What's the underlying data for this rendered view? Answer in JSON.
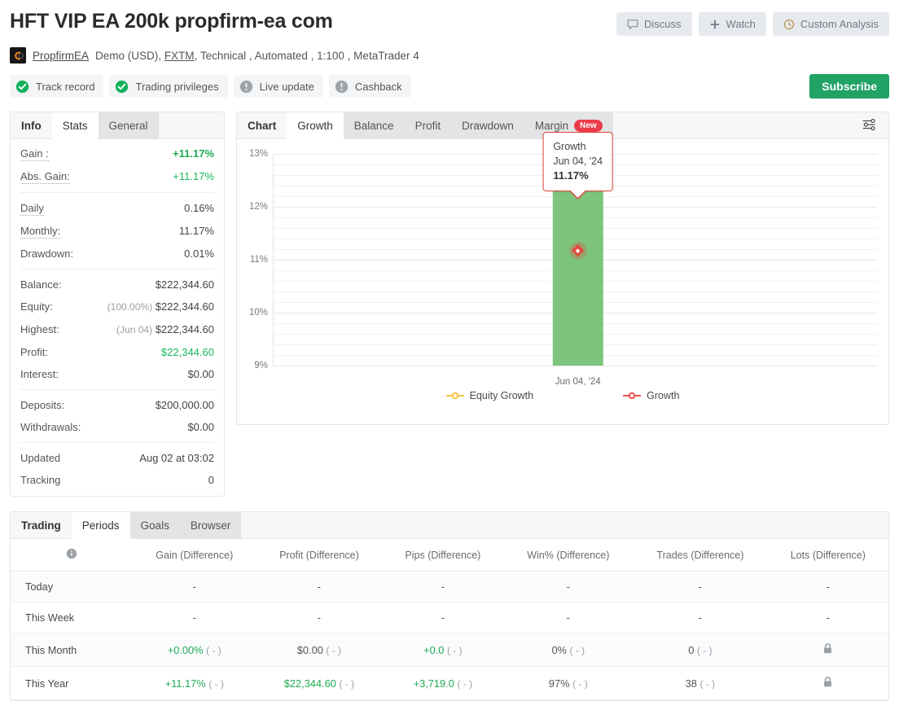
{
  "header": {
    "title": "HFT VIP EA 200k propfirm-ea com",
    "actions": [
      {
        "label": "Discuss",
        "icon": "comment-icon"
      },
      {
        "label": "Watch",
        "icon": "plus-icon"
      },
      {
        "label": "Custom Analysis",
        "icon": "clock-icon"
      }
    ],
    "subscribe_label": "Subscribe",
    "broker": {
      "name": "PropfirmEA",
      "account_type": "Demo (USD),",
      "broker_link": "FXTM",
      "meta": ", Technical , Automated , 1:100 , MetaTrader 4"
    },
    "badges": [
      {
        "label": "Track record",
        "state": "ok"
      },
      {
        "label": "Trading privileges",
        "state": "ok"
      },
      {
        "label": "Live update",
        "state": "warn"
      },
      {
        "label": "Cashback",
        "state": "warn"
      }
    ]
  },
  "stats_panel": {
    "tabs": [
      {
        "label": "Info",
        "state": "bold"
      },
      {
        "label": "Stats",
        "state": "active"
      },
      {
        "label": "General",
        "state": "grey"
      }
    ],
    "groups": [
      [
        {
          "key": "Gain :",
          "value": "+11.17%",
          "style": "green",
          "dotted": true
        },
        {
          "key": "Abs. Gain:",
          "value": "+11.17%",
          "style": "green-n",
          "dotted": true
        }
      ],
      [
        {
          "key": "Daily",
          "value": "0.16%",
          "dotted": true
        },
        {
          "key": "Monthly:",
          "value": "11.17%",
          "dotted": true
        },
        {
          "key": "Drawdown:",
          "value": "0.01%",
          "dotted": false
        }
      ],
      [
        {
          "key": "Balance:",
          "value": "$222,344.60"
        },
        {
          "key": "Equity:",
          "value": "$222,344.60",
          "prefix": "(100.00%)"
        },
        {
          "key": "Highest:",
          "value": "$222,344.60",
          "prefix": "(Jun 04)"
        },
        {
          "key": "Profit:",
          "value": "$22,344.60",
          "style": "green-n"
        },
        {
          "key": "Interest:",
          "value": "$0.00"
        }
      ],
      [
        {
          "key": "Deposits:",
          "value": "$200,000.00"
        },
        {
          "key": "Withdrawals:",
          "value": "$0.00"
        }
      ],
      [
        {
          "key": "Updated",
          "value": "Aug 02 at 03:02"
        },
        {
          "key": "Tracking",
          "value": "0"
        }
      ]
    ]
  },
  "chart_panel": {
    "tabs": [
      {
        "label": "Chart",
        "state": "bold"
      },
      {
        "label": "Growth",
        "state": "active"
      },
      {
        "label": "Balance",
        "state": "grey"
      },
      {
        "label": "Profit",
        "state": "grey"
      },
      {
        "label": "Drawdown",
        "state": "grey"
      },
      {
        "label": "Margin",
        "state": "grey",
        "badge": "New"
      }
    ],
    "settings_icon": "sliders-icon"
  },
  "chart_data": {
    "type": "bar",
    "title": "",
    "xlabel": "",
    "ylabel": "",
    "categories": [
      "Jun 04, '24"
    ],
    "series": [
      {
        "name": "Growth",
        "color": "#ef5350",
        "values": [
          11.17
        ]
      },
      {
        "name": "Equity Growth",
        "color": "#f5c242",
        "values": [
          11.17
        ]
      }
    ],
    "bars": [
      {
        "category": "Jun 04, '24",
        "low": 9.0,
        "high": 12.72,
        "color": "#7dc47d"
      }
    ],
    "ylim": [
      9,
      13
    ],
    "yticks": [
      9,
      10,
      11,
      12,
      13
    ],
    "ytick_labels": [
      "9%",
      "10%",
      "11%",
      "12%",
      "13%"
    ],
    "minor_gridlines": true,
    "grid": true,
    "legend_position": "bottom",
    "legend": [
      "Equity Growth",
      "Growth"
    ],
    "tooltip": {
      "series": "Growth",
      "date": "Jun 04, '24",
      "value": "11.17%",
      "point_y": 11.17
    }
  },
  "bottom_panel": {
    "tabs": [
      {
        "label": "Trading",
        "state": "bold"
      },
      {
        "label": "Periods",
        "state": "active"
      },
      {
        "label": "Goals",
        "state": "grey"
      },
      {
        "label": "Browser",
        "state": "grey"
      }
    ],
    "columns": [
      {
        "label": "",
        "icon": "info-icon"
      },
      {
        "label": "Gain (Difference)"
      },
      {
        "label": "Profit (Difference)"
      },
      {
        "label": "Pips (Difference)"
      },
      {
        "label": "Win% (Difference)"
      },
      {
        "label": "Trades (Difference)"
      },
      {
        "label": "Lots (Difference)"
      }
    ],
    "rows": [
      {
        "period": "Today",
        "cells": [
          {
            "text": "-"
          },
          {
            "text": "-"
          },
          {
            "text": "-"
          },
          {
            "text": "-"
          },
          {
            "text": "-"
          },
          {
            "text": "-"
          }
        ]
      },
      {
        "period": "This Week",
        "cells": [
          {
            "text": "-"
          },
          {
            "text": "-"
          },
          {
            "text": "-"
          },
          {
            "text": "-"
          },
          {
            "text": "-"
          },
          {
            "text": "-"
          }
        ]
      },
      {
        "period": "This Month",
        "cells": [
          {
            "text": "+0.00%",
            "green": true,
            "diff": "( - )"
          },
          {
            "text": "$0.00",
            "diff": "( - )"
          },
          {
            "text": "+0.0",
            "green": true,
            "diff": "( - )"
          },
          {
            "text": "0%",
            "diff": "( - )"
          },
          {
            "text": "0",
            "diff": "( - )"
          },
          {
            "icon": "lock-icon"
          }
        ]
      },
      {
        "period": "This Year",
        "cells": [
          {
            "text": "+11.17%",
            "green": true,
            "diff": "( - )"
          },
          {
            "text": "$22,344.60",
            "green": true,
            "diff": "( - )"
          },
          {
            "text": "+3,719.0",
            "green": true,
            "diff": "( - )"
          },
          {
            "text": "97%",
            "diff": "( - )"
          },
          {
            "text": "38",
            "diff": "( - )"
          },
          {
            "icon": "lock-icon"
          }
        ]
      }
    ]
  },
  "colors": {
    "green": "#21a366",
    "bar_green": "#7dc47d",
    "marker_red": "#e24b3c",
    "equity_yellow": "#f5c242",
    "badge_red": "#ec3b49"
  }
}
